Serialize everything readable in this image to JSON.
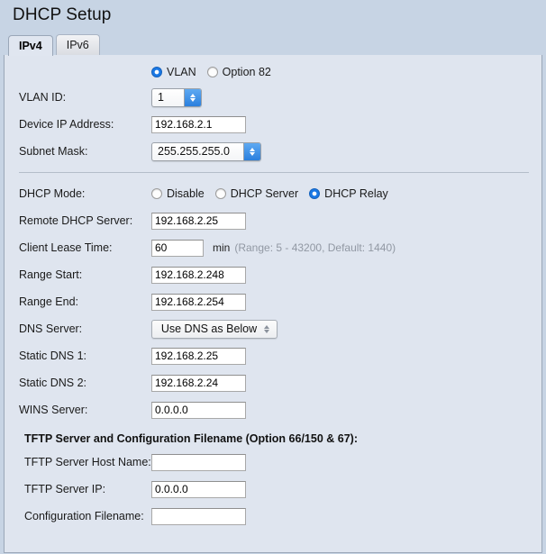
{
  "page": {
    "title": "DHCP Setup"
  },
  "tabs": [
    {
      "label": "IPv4",
      "active": true
    },
    {
      "label": "IPv6",
      "active": false
    }
  ],
  "mode_selector": {
    "options": [
      {
        "label": "VLAN",
        "checked": true
      },
      {
        "label": "Option 82",
        "checked": false
      }
    ]
  },
  "fields": {
    "vlan_id": {
      "label": "VLAN ID:",
      "value": "1"
    },
    "device_ip": {
      "label": "Device IP Address:",
      "value": "192.168.2.1"
    },
    "subnet_mask": {
      "label": "Subnet Mask:",
      "value": "255.255.255.0"
    },
    "dhcp_mode": {
      "label": "DHCP Mode:",
      "options": [
        {
          "label": "Disable",
          "checked": false
        },
        {
          "label": "DHCP Server",
          "checked": false
        },
        {
          "label": "DHCP Relay",
          "checked": true
        }
      ]
    },
    "remote_dhcp_server": {
      "label": "Remote DHCP Server:",
      "value": "192.168.2.25"
    },
    "client_lease_time": {
      "label": "Client Lease Time:",
      "value": "60",
      "unit": "min",
      "range_hint": "(Range: 5 - 43200, Default: 1440)"
    },
    "range_start": {
      "label": "Range Start:",
      "value": "192.168.2.248"
    },
    "range_end": {
      "label": "Range End:",
      "value": "192.168.2.254"
    },
    "dns_server": {
      "label": "DNS Server:",
      "value": "Use DNS as Below"
    },
    "static_dns_1": {
      "label": "Static DNS 1:",
      "value": "192.168.2.25"
    },
    "static_dns_2": {
      "label": "Static DNS 2:",
      "value": "192.168.2.24"
    },
    "wins_server": {
      "label": "WINS Server:",
      "value": "0.0.0.0"
    }
  },
  "tftp_section": {
    "heading": "TFTP Server and Configuration Filename (Option 66/150 & 67):",
    "tftp_host_name": {
      "label": "TFTP Server Host Name:",
      "value": ""
    },
    "tftp_server_ip": {
      "label": "TFTP Server IP:",
      "value": "0.0.0.0"
    },
    "config_filename": {
      "label": "Configuration Filename:",
      "value": ""
    }
  },
  "colors": {
    "accent": "#2a7fdd",
    "panel_bg": "#dfe5ef",
    "header_bg": "#c7d4e4",
    "hint_text": "#9198a3"
  }
}
